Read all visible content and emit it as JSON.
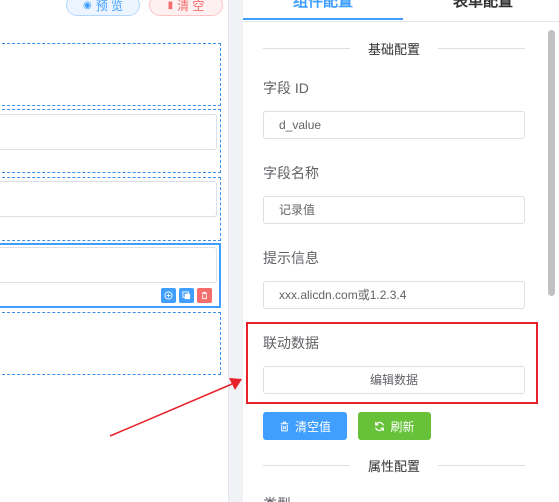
{
  "canvas": {
    "preview_label": "预 览",
    "clear_label": "清 空"
  },
  "panel": {
    "tabs": [
      {
        "label": "组件配置"
      },
      {
        "label": "表单配置"
      }
    ],
    "basic_section": "基础配置",
    "field_id": {
      "label": "字段 ID",
      "value": "d_value"
    },
    "field_name": {
      "label": "字段名称",
      "value": "记录值"
    },
    "tip": {
      "label": "提示信息",
      "placeholder": "xxx.alicdn.com或1.2.3.4"
    },
    "linked_data": {
      "label": "联动数据",
      "edit_button": "编辑数据"
    },
    "actions": {
      "clear_value": "清空值",
      "refresh": "刷新"
    },
    "attr_section": "属性配置",
    "type_label": "类型"
  },
  "colors": {
    "primary": "#409eff",
    "success": "#67c23a",
    "danger": "#f56c6c",
    "annotation": "#e8222b"
  },
  "icons": {
    "preview": "eye-icon",
    "clear": "trash-icon",
    "add": "plus-circle-icon",
    "copy": "copy-icon",
    "delete": "trash-icon",
    "refresh": "refresh-icon"
  }
}
